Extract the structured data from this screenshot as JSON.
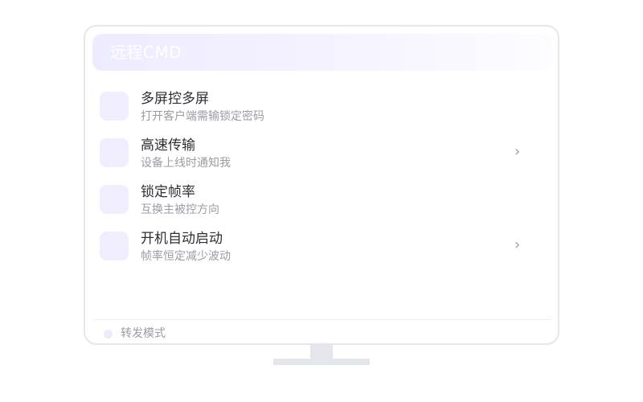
{
  "window": {
    "title": "远程CMD"
  },
  "list": {
    "items": [
      {
        "title": "多屏控多屏",
        "subtitle": "打开客户端需输锁定密码",
        "icon": "feature-icon",
        "has_chevron": false
      },
      {
        "title": "高速传输",
        "subtitle": "设备上线时通知我",
        "icon": "feature-icon",
        "has_chevron": true,
        "chevron": "›"
      },
      {
        "title": "锁定帧率",
        "subtitle": "互换主被控方向",
        "icon": "feature-icon",
        "has_chevron": false
      },
      {
        "title": "开机自动启动",
        "subtitle": "帧率恒定减少波动",
        "icon": "feature-icon",
        "has_chevron": true,
        "chevron": "›"
      }
    ]
  },
  "footer": {
    "mode_label": "转发模式"
  },
  "colors": {
    "accent_soft": "#f0eefc",
    "text_primary": "#2d2f36",
    "text_secondary": "#9a9ca6",
    "border": "#e6e7ec"
  }
}
